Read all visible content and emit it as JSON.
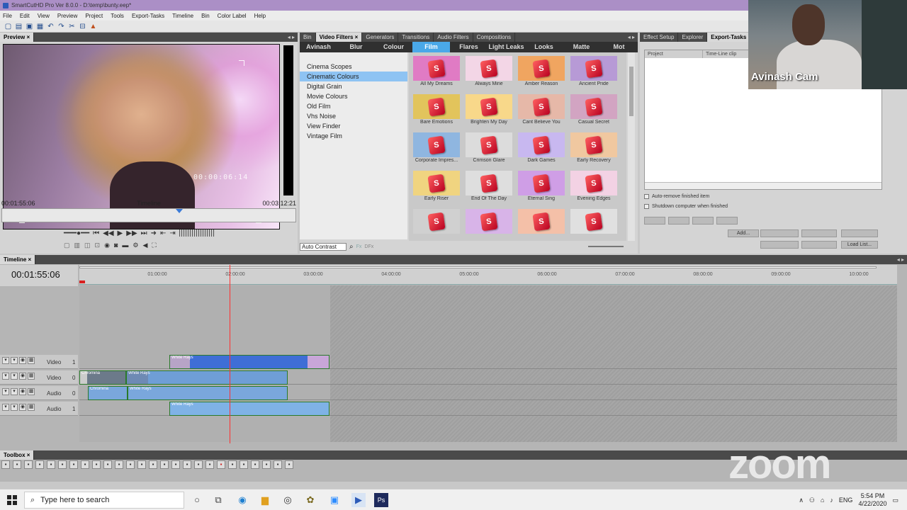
{
  "window": {
    "title": "SmartCutHD Pro Ver 8.0.0 - D:\\temp\\bunty.eep*"
  },
  "menu": [
    "File",
    "Edit",
    "View",
    "Preview",
    "Project",
    "Tools",
    "Export-Tasks",
    "Timeline",
    "Bin",
    "Color Label",
    "Help"
  ],
  "preview": {
    "tab": "Preview",
    "overlay_timecode": "00:00:06:14",
    "current_time": "00:01:55:06",
    "label": "Timeline",
    "duration": "00:03:12:21"
  },
  "filters": {
    "tabs": [
      "Bin",
      "Video Filters",
      "Generators",
      "Transitions",
      "Audio Filters",
      "Compositions"
    ],
    "active_tab": "Video Filters",
    "categories": [
      "Avinash",
      "Blur",
      "Colour",
      "Film",
      "Flares",
      "Light Leaks",
      "Looks",
      "Matte",
      "Mot"
    ],
    "active_category": "Film",
    "list": [
      "Cinema Scopes",
      "Cinematic Colours",
      "Digital Grain",
      "Movie Colours",
      "Old Film",
      "Vhs Noise",
      "View Finder",
      "Vintage Film"
    ],
    "selected": "Cinematic Colours",
    "thumbs": [
      {
        "label": "All My Dreams",
        "bg": "#e07bc4"
      },
      {
        "label": "Always Mine",
        "bg": "#f3d6e6"
      },
      {
        "label": "Amber Reason",
        "bg": "#f0a560"
      },
      {
        "label": "Ancient Pride",
        "bg": "#b79ad6"
      },
      {
        "label": "Bare Emotions",
        "bg": "#e2c45c"
      },
      {
        "label": "Brighten My Day",
        "bg": "#f8d88a"
      },
      {
        "label": "Cant Believe You",
        "bg": "#e6b8a8"
      },
      {
        "label": "Casual Secret",
        "bg": "#d2a4c2"
      },
      {
        "label": "Corporate Impres...",
        "bg": "#8fb6e0"
      },
      {
        "label": "Crimson Glare",
        "bg": "#dcdcdc"
      },
      {
        "label": "Dark Games",
        "bg": "#c8b8f0"
      },
      {
        "label": "Early Recovery",
        "bg": "#f0c8a0"
      },
      {
        "label": "Early Riser",
        "bg": "#f0d480"
      },
      {
        "label": "End Of The Day",
        "bg": "#dedede"
      },
      {
        "label": "Eternal Sing",
        "bg": "#cf9ee6"
      },
      {
        "label": "Evening Edges",
        "bg": "#f3d2e4"
      },
      {
        "label": "",
        "bg": "#d0d0d0"
      },
      {
        "label": "",
        "bg": "#d8b4e8"
      },
      {
        "label": "",
        "bg": "#f4c0a8"
      },
      {
        "label": "",
        "bg": "#e0e0e0"
      }
    ],
    "search_value": "Auto Contrast"
  },
  "export": {
    "tabs": [
      "Effect Setup",
      "Explorer",
      "Export-Tasks"
    ],
    "active_tab": "Export-Tasks",
    "columns": [
      "Project",
      "Time-Line clip"
    ],
    "auto_remove": "Auto-remove finished item",
    "shutdown": "Shutdown computer when finished",
    "add_label": "Add...",
    "load_label": "Load List..."
  },
  "webcam": {
    "label": "Avinash Cam"
  },
  "timeline": {
    "tab": "Timeline",
    "current_time": "00:01:55:06",
    "ruler": [
      "01:00:00",
      "02:00:00",
      "03:00:00",
      "04:00:00",
      "05:00:00",
      "06:00:00",
      "07:00:00",
      "08:00:00",
      "09:00:00",
      "10:00:00"
    ],
    "tracks": [
      {
        "name": "Video",
        "num": "1"
      },
      {
        "name": "Video",
        "num": "0"
      },
      {
        "name": "Audio",
        "num": "0"
      },
      {
        "name": "Audio",
        "num": "1"
      }
    ],
    "clips": {
      "white_rays": "White Rays",
      "chromina": "Chromina"
    }
  },
  "toolbox": {
    "tab": "Toolbox"
  },
  "taskbar": {
    "search_placeholder": "Type here to search",
    "lang": "ENG",
    "time": "5:54 PM",
    "date": "4/22/2020"
  },
  "zoom_logo": "zoom"
}
